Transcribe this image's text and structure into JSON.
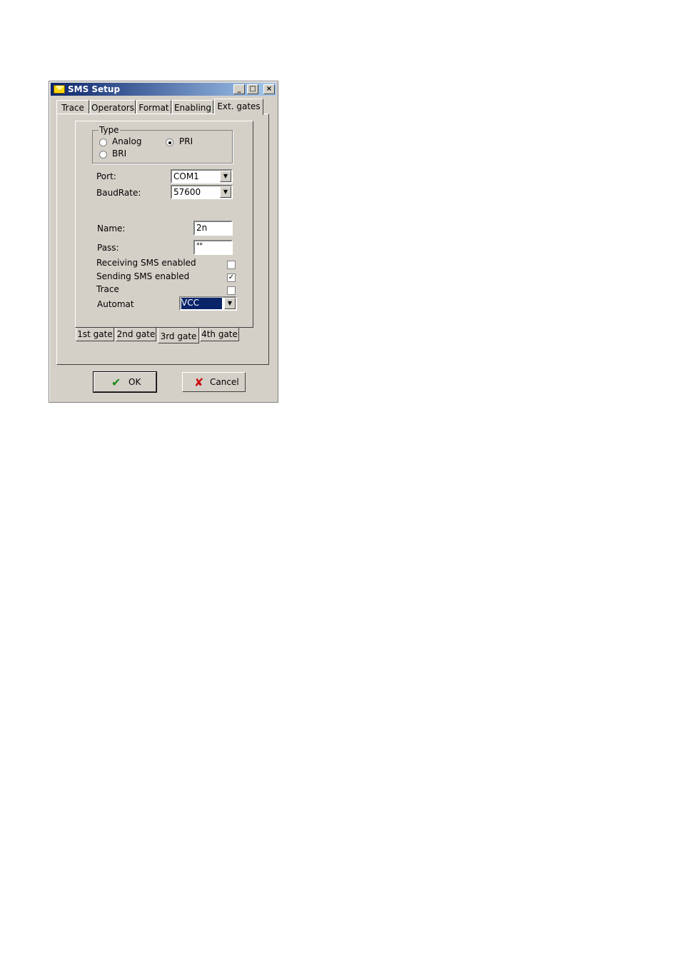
{
  "window": {
    "title": "SMS Setup",
    "controls": {
      "minimize": "_",
      "maximize": "□",
      "close": "×"
    }
  },
  "tabs": [
    "Trace",
    "Operators",
    "Format",
    "Enabling",
    "Ext. gates"
  ],
  "active_tab": "Ext. gates",
  "type_group": {
    "label": "Type",
    "options": {
      "analog": "Analog",
      "pri": "PRI",
      "bri": "BRI"
    },
    "selected": "PRI"
  },
  "port": {
    "label": "Port:",
    "value": "COM1"
  },
  "baud": {
    "label": "BaudRate:",
    "value": "57600"
  },
  "name": {
    "label": "Name:",
    "value": "2n"
  },
  "pass": {
    "label": "Pass:",
    "value": "**"
  },
  "receiving": {
    "label": "Receiving SMS enabled",
    "checked": false
  },
  "sending": {
    "label": "Sending SMS enabled",
    "checked": true,
    "mark": "✓"
  },
  "trace": {
    "label": "Trace",
    "checked": false
  },
  "automat": {
    "label": "Automat",
    "value": "VCC"
  },
  "gate_tabs": [
    "1st gate",
    "2nd gate",
    "3rd gate",
    "4th gate"
  ],
  "active_gate": "3rd gate",
  "buttons": {
    "ok": "OK",
    "cancel": "Cancel",
    "ok_icon": "✔",
    "cancel_icon": "✘"
  },
  "colors": {
    "ok_icon": "#1a8a1a",
    "cancel_icon": "#cc1111",
    "selection": "#0a246a"
  }
}
